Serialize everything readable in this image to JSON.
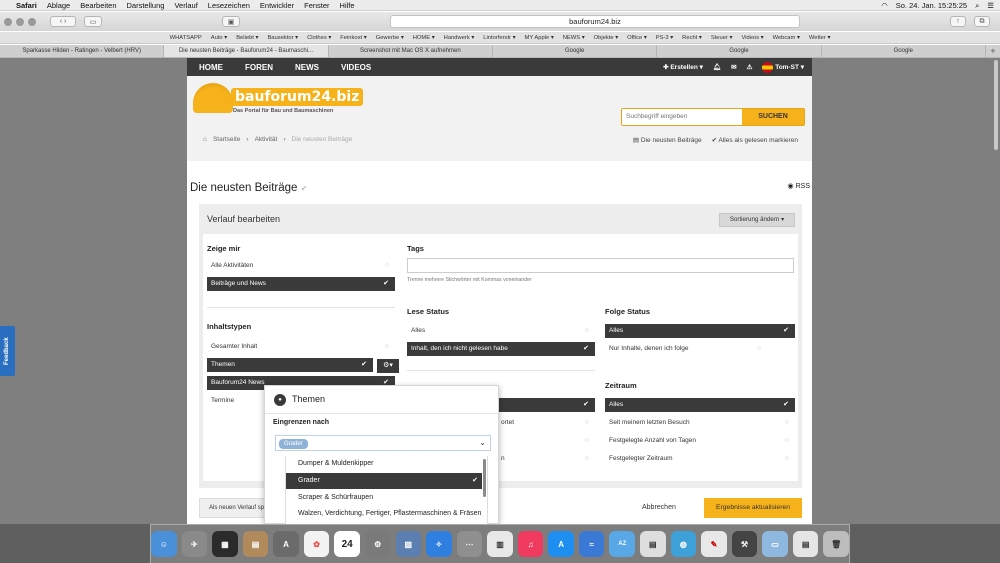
{
  "menubar": {
    "app": "Safari",
    "items": [
      "Ablage",
      "Bearbeiten",
      "Darstellung",
      "Verlauf",
      "Lesezeichen",
      "Entwickler",
      "Fenster",
      "Hilfe"
    ],
    "clock": "So. 24. Jan.  15:25:25"
  },
  "toolbar": {
    "url": "bauforum24.biz"
  },
  "bookmarks": [
    "WHATSAPP",
    "Auto ▾",
    "Beliebt ▾",
    "Bausektor ▾",
    "Clothes ▾",
    "Feinkost ▾",
    "Gewerbe ▾",
    "HOME ▾",
    "Handwerk ▾",
    "Lintorferstr ▾",
    "MY Apple ▾",
    "NEWS ▾",
    "Objekte ▾",
    "Office ▾",
    "PS-3 ▾",
    "Recht ▾",
    "Steuer ▾",
    "Videos ▾",
    "Webcam ▾",
    "Wetter ▾"
  ],
  "tabs": [
    {
      "label": "Sparkasse Hilden - Ratingen - Velbert (HRV)",
      "active": false
    },
    {
      "label": "Die neusten Beiträge - Bauforum24 - Baumaschi...",
      "active": true
    },
    {
      "label": "Screenshot mit Mac OS X aufnehmen",
      "active": false
    },
    {
      "label": "Google",
      "active": false
    },
    {
      "label": "Google",
      "active": false
    },
    {
      "label": "Google",
      "active": false
    }
  ],
  "feedback": "Feedback",
  "nav": {
    "items": [
      "HOME",
      "FOREN",
      "NEWS",
      "VIDEOS"
    ],
    "create": "✚ Erstellen ▾",
    "user": "Tom-ST ▾"
  },
  "logo": {
    "name": "bauforum24.biz",
    "tagline": "Das Portal für Bau und Baumaschinen"
  },
  "search": {
    "placeholder": "Suchbegriff eingeben",
    "button": "SUCHEN"
  },
  "breadcrumb": [
    "Startseite",
    "Aktivität",
    "Die neusten Beiträge"
  ],
  "crumb_actions": {
    "newest": "Die neusten Beiträge",
    "mark_read": "Alles als gelesen markieren"
  },
  "page_title": "Die neusten Beiträge",
  "rss": "RSS",
  "panel": {
    "title": "Verlauf bearbeiten",
    "sort": "Sortierung ändern ▾"
  },
  "show": {
    "title": "Zeige mir",
    "options": [
      {
        "label": "Alle Aktivitäten",
        "selected": false
      },
      {
        "label": "Beiträge und News",
        "selected": true
      }
    ]
  },
  "content_types": {
    "title": "Inhaltstypen",
    "options": [
      {
        "label": "Gesamter Inhalt",
        "selected": false
      },
      {
        "label": "Themen",
        "selected": true
      },
      {
        "label": "Bauforum24 News",
        "selected": true
      },
      {
        "label": "Termine",
        "selected": false
      }
    ]
  },
  "tags": {
    "title": "Tags",
    "help": "Trenne mehrere Stichwörter mit Kommas voneinander"
  },
  "read_status": {
    "title": "Lese Status",
    "options": [
      {
        "label": "Alles",
        "selected": false
      },
      {
        "label": "Inhalt, den ich nicht gelesen habe",
        "selected": true
      }
    ]
  },
  "follow_status": {
    "title": "Folge Status",
    "options": [
      {
        "label": "Alles",
        "selected": true
      },
      {
        "label": "Nur Inhalte, denen ich folge",
        "selected": false
      }
    ]
  },
  "hidden_partial": [
    "ortet",
    "n"
  ],
  "timeframe": {
    "title": "Zeitraum",
    "options": [
      {
        "label": "Alles",
        "selected": true
      },
      {
        "label": "Seit meinem letzten Besuch",
        "selected": false
      },
      {
        "label": "Festgelegte Anzahl von Tagen",
        "selected": false
      },
      {
        "label": "Festgelegter Zeitraum",
        "selected": false
      }
    ]
  },
  "footer": {
    "new_stream": "Als neuen Verlauf speichern",
    "cancel": "Abbrechen",
    "apply": "Ergebnisse aktualisieren"
  },
  "popover": {
    "title": "Themen",
    "label": "Eingrenzen nach",
    "chip": "Grader",
    "list": [
      {
        "label": "Dumper & Muldenkipper",
        "selected": false
      },
      {
        "label": "Grader",
        "selected": true
      },
      {
        "label": "Scraper & Schürfraupen",
        "selected": false
      },
      {
        "label": "Walzen, Verdichtung, Fertiger, Pflastermaschinen & Fräsen",
        "selected": false
      }
    ]
  },
  "dock": {
    "calendar_day": "24"
  }
}
